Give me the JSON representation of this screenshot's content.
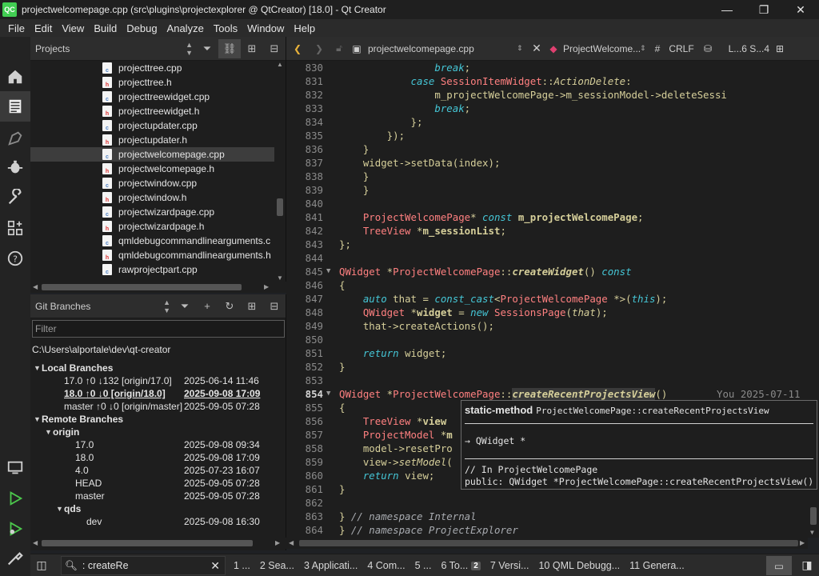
{
  "window": {
    "app_icon_label": "QC",
    "title": "projectwelcomepage.cpp (src\\plugins\\projectexplorer @ QtCreator) [18.0] - Qt Creator",
    "minimize": "—",
    "maximize": "❐",
    "close": "✕"
  },
  "menu": [
    "File",
    "Edit",
    "View",
    "Build",
    "Debug",
    "Analyze",
    "Tools",
    "Window",
    "Help"
  ],
  "modes": [
    "home-icon",
    "edit-icon",
    "design-icon",
    "debug-icon",
    "projects-icon",
    "extensions-icon",
    "help-icon",
    "kit-selector-icon",
    "run-icon",
    "debug-run-icon",
    "build-icon"
  ],
  "projects": {
    "header": "Projects",
    "files": [
      {
        "name": "projecttree.cpp",
        "type": "cpp"
      },
      {
        "name": "projecttree.h",
        "type": "h"
      },
      {
        "name": "projecttreewidget.cpp",
        "type": "cpp"
      },
      {
        "name": "projecttreewidget.h",
        "type": "h"
      },
      {
        "name": "projectupdater.cpp",
        "type": "cpp"
      },
      {
        "name": "projectupdater.h",
        "type": "h"
      },
      {
        "name": "projectwelcomepage.cpp",
        "type": "cpp",
        "selected": true
      },
      {
        "name": "projectwelcomepage.h",
        "type": "h"
      },
      {
        "name": "projectwindow.cpp",
        "type": "cpp"
      },
      {
        "name": "projectwindow.h",
        "type": "h"
      },
      {
        "name": "projectwizardpage.cpp",
        "type": "cpp"
      },
      {
        "name": "projectwizardpage.h",
        "type": "h"
      },
      {
        "name": "qmldebugcommandlinearguments.c",
        "type": "cpp"
      },
      {
        "name": "qmldebugcommandlinearguments.h",
        "type": "h"
      },
      {
        "name": "rawprojectpart.cpp",
        "type": "cpp"
      }
    ]
  },
  "git": {
    "header": "Git Branches",
    "filter_placeholder": "Filter",
    "repo_path": "C:\\Users\\alportale\\dev\\qt-creator",
    "rows": [
      {
        "indent": 1,
        "tri": "▼",
        "name": "Local Branches",
        "date": "",
        "group": true
      },
      {
        "indent": 3,
        "tri": "",
        "name": "17.0 ↑0 ↓132 [origin/17.0]",
        "date": "2025-06-14 11:46"
      },
      {
        "indent": 3,
        "tri": "",
        "name": "18.0 ↑0 ↓0 [origin/18.0]",
        "date": "2025-09-08 17:09",
        "bold": true
      },
      {
        "indent": 3,
        "tri": "",
        "name": "master ↑0 ↓0 [origin/master]",
        "date": "2025-09-05 07:28"
      },
      {
        "indent": 1,
        "tri": "▼",
        "name": "Remote Branches",
        "date": "",
        "group": true
      },
      {
        "indent": 2,
        "tri": "▼",
        "name": "origin",
        "date": "",
        "group": true
      },
      {
        "indent": 4,
        "tri": "",
        "name": "17.0",
        "date": "2025-09-08 09:34"
      },
      {
        "indent": 4,
        "tri": "",
        "name": "18.0",
        "date": "2025-09-08 17:09"
      },
      {
        "indent": 4,
        "tri": "",
        "name": "4.0",
        "date": "2025-07-23 16:07"
      },
      {
        "indent": 4,
        "tri": "",
        "name": "HEAD",
        "date": "2025-09-05 07:28"
      },
      {
        "indent": 4,
        "tri": "",
        "name": "master",
        "date": "2025-09-05 07:28"
      },
      {
        "indent": 3,
        "tri": "▼",
        "name": "qds",
        "date": "",
        "group": true
      },
      {
        "indent": 5,
        "tri": "",
        "name": "dev",
        "date": "2025-09-08 16:30"
      }
    ]
  },
  "editor_toolbar": {
    "file_name": "projectwelcomepage.cpp",
    "symbol": "ProjectWelcome...",
    "hash": "#",
    "line_ending": "CRLF",
    "position": "L...6  S...4"
  },
  "editor": {
    "current_line": 854,
    "blame": "You 2025-07-11",
    "lines": [
      {
        "n": 830,
        "html": "                <span class=\"kw\">break</span>;"
      },
      {
        "n": 831,
        "html": "            <span class=\"kw\">case</span> <span class=\"ty\">SessionItemWidget</span>::<span class=\"fn\">ActionDelete</span>:"
      },
      {
        "n": 832,
        "html": "                m_projectWelcomePage-&gt;m_sessionModel-&gt;deleteSessi"
      },
      {
        "n": 833,
        "html": "                <span class=\"kw\">break</span>;"
      },
      {
        "n": 834,
        "html": "            };"
      },
      {
        "n": 835,
        "html": "        });"
      },
      {
        "n": 836,
        "html": "    }"
      },
      {
        "n": 837,
        "html": "    widget-&gt;setData(index);"
      },
      {
        "n": 838,
        "html": "    }"
      },
      {
        "n": 839,
        "html": "    }"
      },
      {
        "n": 840,
        "html": ""
      },
      {
        "n": 841,
        "html": "    <span class=\"ty\">ProjectWelcomePage</span>* <span class=\"kw\">const</span> <span class=\"mb\">m_projectWelcomePage</span>;"
      },
      {
        "n": 842,
        "html": "    <span class=\"ty\">TreeView</span> *<span class=\"mb\">m_sessionList</span>;"
      },
      {
        "n": 843,
        "html": "};"
      },
      {
        "n": 844,
        "html": ""
      },
      {
        "n": 845,
        "html": "<span class=\"ty\">QWidget</span> *<span class=\"ty\">ProjectWelcomePage</span>::<span class=\"fn\"><b>createWidget</b></span>() <span class=\"kw\">const</span>",
        "fold": true
      },
      {
        "n": 846,
        "html": "{"
      },
      {
        "n": 847,
        "html": "    <span class=\"kw\">auto</span> that = <span class=\"kw\">const_cast</span>&lt;<span class=\"ty\">ProjectWelcomePage</span> *&gt;(<span class=\"kw\">this</span>);"
      },
      {
        "n": 848,
        "html": "    <span class=\"ty\">QWidget</span> *<b>widget</b> = <span class=\"kw\">new</span> <span class=\"ty\">SessionsPage</span>(<span class=\"fn\">that</span>);"
      },
      {
        "n": 849,
        "html": "    that-&gt;createActions();"
      },
      {
        "n": 850,
        "html": ""
      },
      {
        "n": 851,
        "html": "    <span class=\"kw\">return</span> widget;"
      },
      {
        "n": 852,
        "html": "}"
      },
      {
        "n": 853,
        "html": ""
      },
      {
        "n": 854,
        "html": "<span class=\"ty\">QWidget</span> *<span class=\"ty\">ProjectWelcomePage</span>::<span class=\"fn hl\"><b>createRecentProjectsView</b></span>()",
        "fold": true
      },
      {
        "n": 855,
        "html": "{"
      },
      {
        "n": 856,
        "html": "    <span class=\"ty\">TreeView</span> *<b>view</b>"
      },
      {
        "n": 857,
        "html": "    <span class=\"ty\">ProjectModel</span> *<b>m</b>"
      },
      {
        "n": 858,
        "html": "    model-&gt;resetPro"
      },
      {
        "n": 859,
        "html": "    view-&gt;<span class=\"fn\">setModel</span>("
      },
      {
        "n": 860,
        "html": "    <span class=\"kw\">return</span> view;"
      },
      {
        "n": 861,
        "html": "}"
      },
      {
        "n": 862,
        "html": ""
      },
      {
        "n": 863,
        "html": "} <span class=\"cm\">// namespace Internal</span>"
      },
      {
        "n": 864,
        "html": "} <span class=\"cm\">// namespace ProjectExplorer</span>"
      }
    ]
  },
  "tooltip": {
    "kind": "static-method",
    "signature": "ProjectWelcomePage::createRecentProjectsView",
    "returns": "→ QWidget *",
    "comment": "// In ProjectWelcomePage",
    "declaration": "public: QWidget *ProjectWelcomePage::createRecentProjectsView()"
  },
  "statusbar": {
    "locator_value": ": createRe",
    "panes": [
      "1 ...",
      "2 Sea...",
      "3 Applicati...",
      "4 Com...",
      "5 ...",
      "6 To...",
      "7 Versi...",
      "10 QML Debugg...",
      "11 Genera..."
    ],
    "todo_badge": "2"
  }
}
